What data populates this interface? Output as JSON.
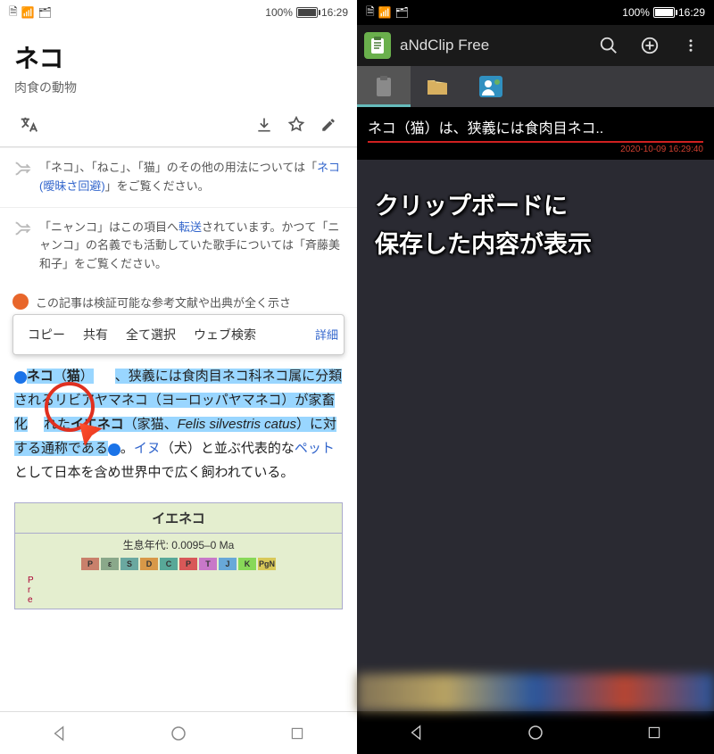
{
  "status": {
    "battery_pct": "100%",
    "time": "16:29"
  },
  "left": {
    "title": "ネコ",
    "subtitle": "肉食の動物",
    "hatnote1_pre": "「ネコ」、「ねこ」、「猫」のその他の用法については「",
    "hatnote1_link": "ネコ (曖昧さ回避)",
    "hatnote1_post": "」をご覧ください。",
    "hatnote2_pre": "「ニャンコ」はこの項目へ",
    "hatnote2_link": "転送",
    "hatnote2_mid": "されています。かつて「ニャンコ」の名義でも活動していた歌手については「",
    "hatnote2_name": "斉藤美和子",
    "hatnote2_post": "」をご覧ください。",
    "warning": "この記事は検証可能な参考文献や出典が全く示さ",
    "menu": {
      "copy": "コピー",
      "share": "共有",
      "select_all": "全て選択",
      "web_search": "ウェブ検索",
      "detail": "詳細"
    },
    "body_b1": "ネコ",
    "body_p1": "（",
    "body_b2": "猫",
    "body_p2": "）",
    "body_hl1": "、狭義には食肉目ネコ科ネコ属に分類されるリビアヤマネコ（ヨーロッパヤマネコ）が家畜化",
    "body_hl_mid": "れた",
    "body_b3": "イエネコ",
    "body_p3": "（家猫、",
    "body_i1": "Felis silvestris catus",
    "body_p4": "）に対する通称である",
    "body_tail1": "。",
    "body_link1": "イヌ",
    "body_tail2": "（犬）と並ぶ代表的な",
    "body_link2": "ペット",
    "body_tail3": "として日本を含め世界中で広く飼われている。",
    "infobox": {
      "title": "イエネコ",
      "age": "生息年代: 0.0095–0 Ma",
      "cells": [
        "P",
        "ε",
        "S",
        "D",
        "C",
        "P",
        "T",
        "J",
        "K",
        "PgN"
      ]
    }
  },
  "right": {
    "app_title": "aNdClip Free",
    "clip_text": "ネコ（猫）は、狭義には食肉目ネコ..",
    "clip_timestamp": "2020-10-09 16:29:40",
    "annotation_l1": "クリップボードに",
    "annotation_l2": "保存した内容が表示"
  },
  "geo_colors": [
    "#c9806b",
    "#8aa88a",
    "#6aa8a0",
    "#d89848",
    "#58a898",
    "#d85858",
    "#c878c8",
    "#68a8d8",
    "#88d858",
    "#d8c858"
  ]
}
